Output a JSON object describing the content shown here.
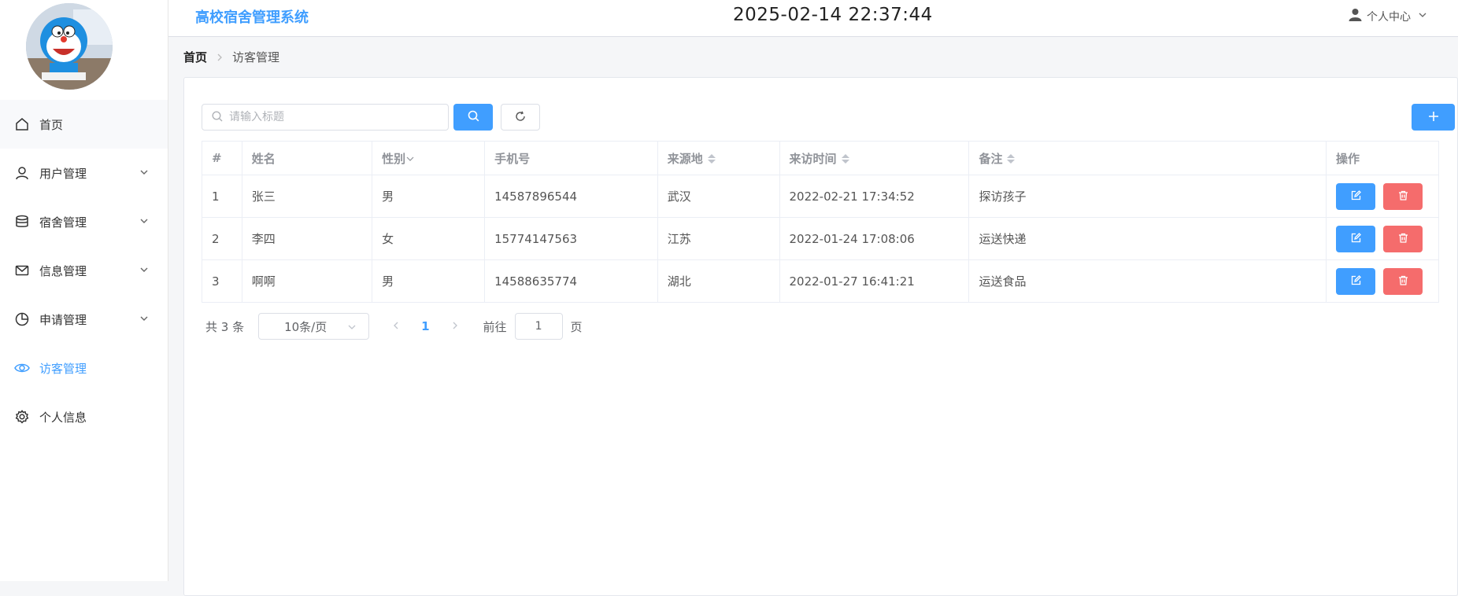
{
  "header": {
    "system_title": "高校宿舍管理系统",
    "datetime": "2025-02-14 22:37:44",
    "user_center": "个人中心"
  },
  "sidebar": {
    "items": [
      {
        "label": "首页",
        "icon": "home-icon"
      },
      {
        "label": "用户管理",
        "icon": "user-icon",
        "expandable": true
      },
      {
        "label": "宿舍管理",
        "icon": "database-icon",
        "expandable": true
      },
      {
        "label": "信息管理",
        "icon": "envelope-icon",
        "expandable": true
      },
      {
        "label": "申请管理",
        "icon": "pie-chart-icon",
        "expandable": true
      },
      {
        "label": "访客管理",
        "icon": "eye-icon",
        "active": true
      },
      {
        "label": "个人信息",
        "icon": "gear-icon"
      }
    ]
  },
  "breadcrumb": {
    "home": "首页",
    "current": "访客管理"
  },
  "search": {
    "placeholder": "请输入标题"
  },
  "table": {
    "columns": [
      "#",
      "姓名",
      "性别",
      "手机号",
      "来源地",
      "来访时间",
      "备注",
      "操作"
    ],
    "rows": [
      {
        "index": "1",
        "name": "张三",
        "gender": "男",
        "phone": "14587896544",
        "origin": "武汉",
        "time": "2022-02-21 17:34:52",
        "note": "探访孩子"
      },
      {
        "index": "2",
        "name": "李四",
        "gender": "女",
        "phone": "15774147563",
        "origin": "江苏",
        "time": "2022-01-24 17:08:06",
        "note": "运送快递"
      },
      {
        "index": "3",
        "name": "啊啊",
        "gender": "男",
        "phone": "14588635774",
        "origin": "湖北",
        "time": "2022-01-27 16:41:21",
        "note": "运送食品"
      }
    ]
  },
  "pagination": {
    "total_text": "共 3 条",
    "page_size": "10条/页",
    "current_page": "1",
    "goto_label": "前往",
    "goto_value": "1",
    "page_unit": "页"
  },
  "colors": {
    "primary": "#409eff",
    "danger": "#f56c6c"
  }
}
